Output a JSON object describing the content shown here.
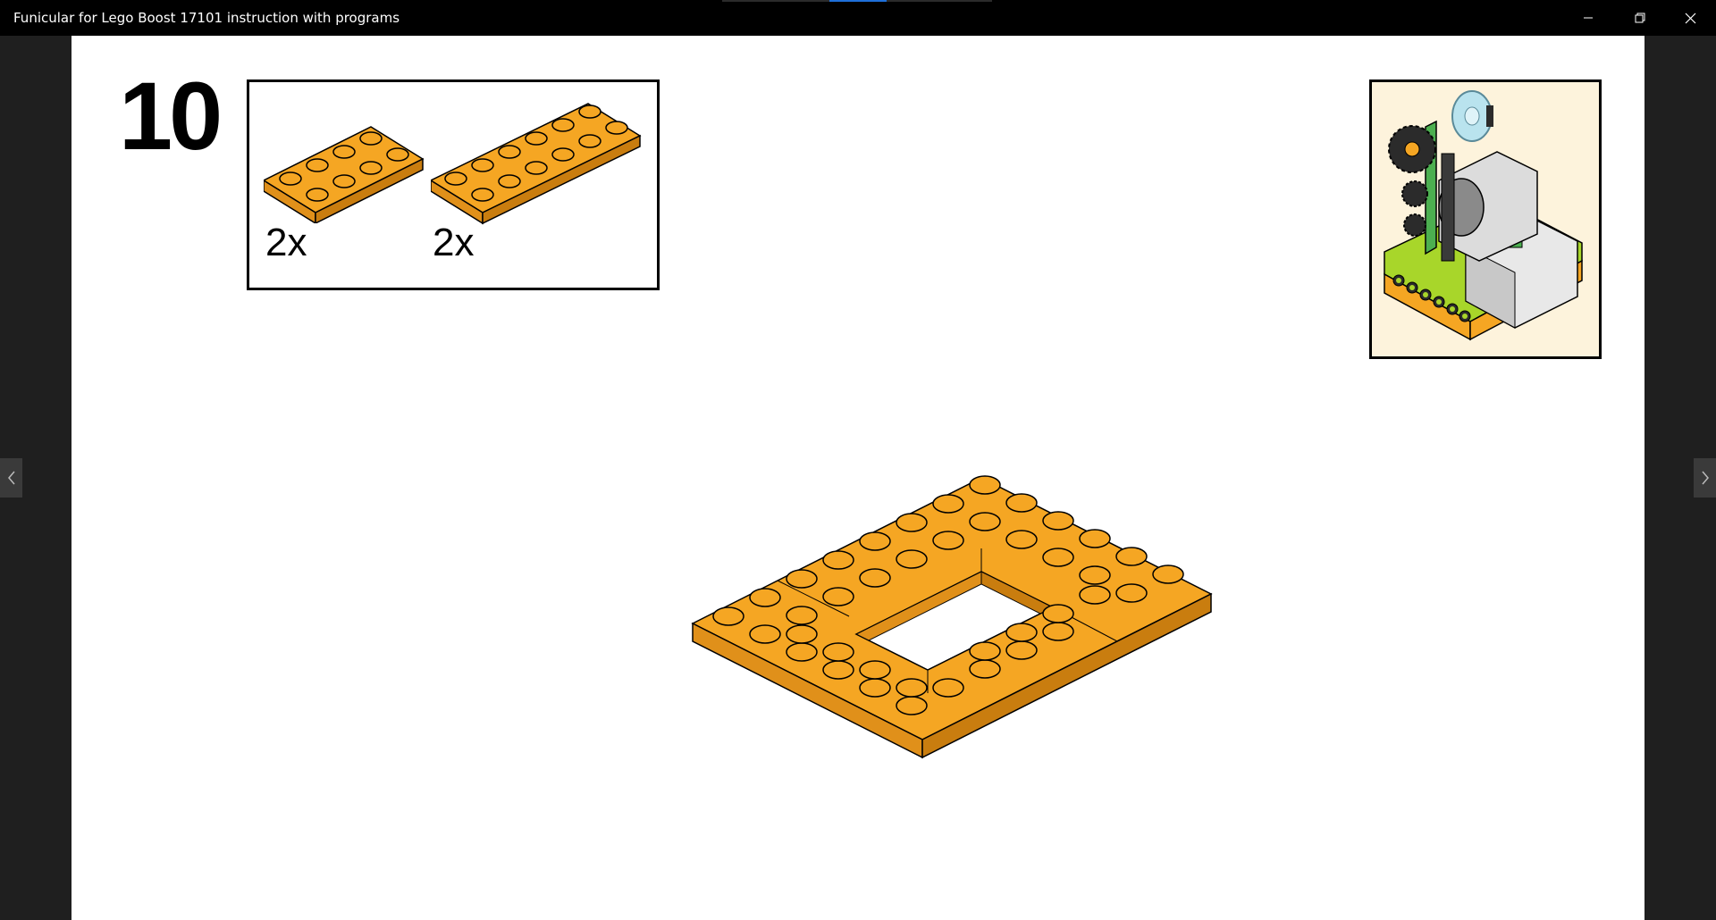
{
  "window": {
    "title": "Funicular for Lego Boost 17101 instruction with programs"
  },
  "load_progress": {
    "fraction": 0.2
  },
  "step": {
    "number": "10",
    "parts": [
      {
        "quantity": "2x",
        "part": "orange-plate-2x4"
      },
      {
        "quantity": "2x",
        "part": "orange-plate-2x6"
      }
    ],
    "colors": {
      "part": "#f5a623",
      "part_shadow": "#d98a12",
      "stud_dark": "#000000"
    }
  },
  "controls": {
    "minimize_icon": "minimize-icon",
    "restore_icon": "restore-icon",
    "close_icon": "close-icon",
    "prev_icon": "chevron-left-icon",
    "next_icon": "chevron-right-icon"
  }
}
